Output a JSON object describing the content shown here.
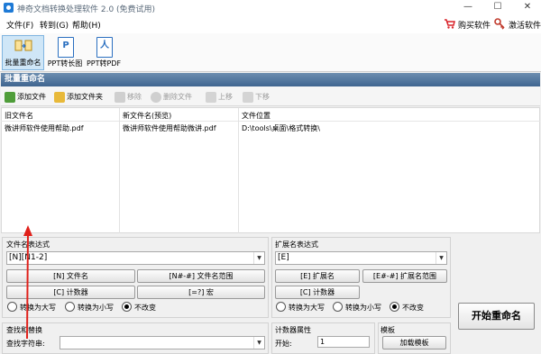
{
  "window": {
    "title": "神奇文档转换处理软件 2.0 (免费试用)",
    "minimize_glyph": "—",
    "maximize_glyph": "☐",
    "close_glyph": "✕"
  },
  "menu": {
    "file": "文件(F)",
    "goto": "转到(G)",
    "help": "帮助(H)",
    "buy": "购买软件",
    "activate": "激活软件"
  },
  "toolbar": {
    "tools": [
      {
        "label": "批量重命名",
        "icon": "rename-icon",
        "selected": true
      },
      {
        "label": "PPT转长图",
        "icon": "ppt-icon",
        "glyph": "P"
      },
      {
        "label": "PPT转PDF",
        "icon": "pdf-icon",
        "glyph": "人"
      }
    ]
  },
  "section_title": "批量重命名",
  "actions": {
    "add_file": "添加文件",
    "add_folder": "添加文件夹",
    "remove": "移除",
    "delete_file": "删除文件",
    "move_up": "上移",
    "move_down": "下移"
  },
  "file_table": {
    "headers": [
      "旧文件名",
      "新文件名(预览)",
      "文件位置"
    ],
    "rows": [
      [
        "微讲师软件使用帮助.pdf",
        "微讲师软件使用帮助微讲.pdf",
        "D:\\tools\\桌面\\格式转换\\"
      ]
    ]
  },
  "filename_expr": {
    "label": "文件名表达式",
    "value": "[N][N1-2]",
    "btn_filename": "[N] 文件名",
    "btn_range": "[N#-#] 文件名范围",
    "btn_counter": "[C] 计数器",
    "btn_macro": "[=?] 宏",
    "radio_upper": "转换为大写",
    "radio_lower": "转换为小写",
    "radio_unchanged": "不改变"
  },
  "ext_expr": {
    "label": "扩展名表达式",
    "value": "[E]",
    "btn_ext": "[E] 扩展名",
    "btn_range": "[E#-#] 扩展名范围",
    "btn_counter": "[C] 计数器",
    "radio_upper": "转换为大写",
    "radio_lower": "转换为小写",
    "radio_unchanged": "不改变"
  },
  "start_button": "开始重命名",
  "find_replace": {
    "label": "查找和替换",
    "find_label": "查找字符串:",
    "find_value": ""
  },
  "counter": {
    "label": "计数器属性",
    "start_label": "开始:",
    "start_value": "1"
  },
  "template": {
    "label": "模板",
    "load_button": "加载模板"
  },
  "colors": {
    "header_blue": "#3f6590",
    "annotation_arrow": "#e0201a",
    "cart_red": "#d9232a"
  }
}
